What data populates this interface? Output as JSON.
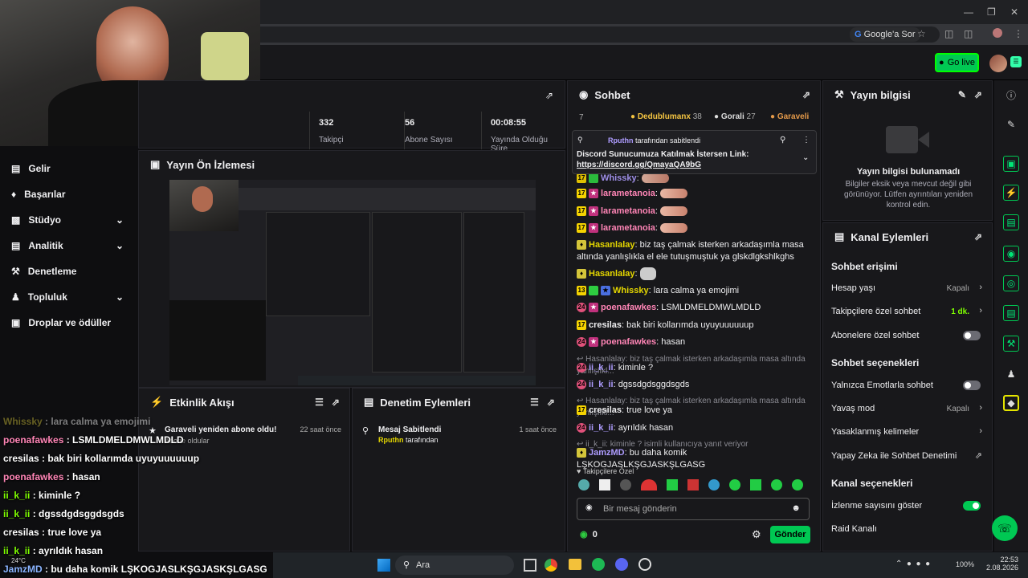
{
  "browser": {
    "google_sor": "Google'a Sor"
  },
  "header": {
    "go_live": "Go live"
  },
  "sidebar": {
    "items": [
      {
        "label": "Gelir",
        "icon": "wallet-icon",
        "chevron": false
      },
      {
        "label": "Başarılar",
        "icon": "trophy-icon",
        "chevron": false
      },
      {
        "label": "Stüdyo",
        "icon": "studio-icon",
        "chevron": true
      },
      {
        "label": "Analitik",
        "icon": "chart-icon",
        "chevron": true
      },
      {
        "label": "Denetleme",
        "icon": "wrench-icon",
        "chevron": false
      },
      {
        "label": "Topluluk",
        "icon": "people-icon",
        "chevron": true
      },
      {
        "label": "Droplar ve ödüller",
        "icon": "gift-icon",
        "chevron": false
      }
    ]
  },
  "stats": [
    {
      "value": "332",
      "label": "Takipçi"
    },
    {
      "value": "56",
      "label": "Abone Sayısı"
    },
    {
      "value": "00:08:55",
      "label": "Yayında Olduğu Süre"
    }
  ],
  "preview": {
    "title": "Yayın Ön İzlemesi"
  },
  "activity": {
    "title": "Etkinlik Akışı",
    "event_text": "Garaveli yeniden abone oldu!",
    "event_time": "22 saat önce",
    "event_sub": "Abone oldular"
  },
  "moderation": {
    "title": "Denetim Eylemleri",
    "action": "Mesaj Sabitlendi",
    "time": "1 saat önce",
    "actor": "Rputhn",
    "actor_suffix": "tarafından"
  },
  "chat": {
    "title": "Sohbet",
    "count": "7",
    "leaders": [
      {
        "rank": "1",
        "name": "Dedublumanx",
        "score": "38"
      },
      {
        "rank": "2",
        "name": "Gorali",
        "score": "27"
      },
      {
        "rank": "3",
        "name": "Garaveli",
        "score": ""
      }
    ],
    "pinned_by": "Rputhn",
    "pinned_suffix": "tarafından sabitlendi",
    "pinned_text": "Discord Sunucumuza Katılmak İstersen Link:",
    "pinned_link": "https://discord.gg/QmayaQA9bG",
    "messages": [
      {
        "user": "Whissky",
        "text": ":",
        "color": "u-g"
      },
      {
        "user": "larametanoia",
        "text": ":",
        "color": "u-pk"
      },
      {
        "user": "larametanoia",
        "text": ":",
        "color": "u-pk"
      },
      {
        "user": "larametanoia",
        "text": ":",
        "color": "u-pk"
      },
      {
        "user": "Hasanlalay",
        "text": ": biz taş çalmak isterken arkadaşımla masa altında yanlışlıkla el ele tutuşmuştuk ya glskdlgkshlkghs",
        "color": "u-y"
      },
      {
        "user": "Hasanlalay",
        "text": ":",
        "color": "u-y"
      },
      {
        "user": "Whissky",
        "text": ": lara calma ya emojimi",
        "color": "u-y"
      },
      {
        "user": "poenafawkes",
        "text": ": LSMLDMELDMWLMDLD",
        "color": "u-pk"
      },
      {
        "user": "cresilas",
        "text": ": bak biri kollarımda uyuyuuuuuup",
        "color": "u-w"
      },
      {
        "user": "poenafawkes",
        "text": ": hasan",
        "color": "u-pk"
      },
      {
        "reply": "Hasanlalay: biz taş çalmak isterken arkadaşımla masa altında yanlışlıkl..."
      },
      {
        "user": "ii_k_ii",
        "text": ": kiminle ?",
        "color": "u-g"
      },
      {
        "user": "ii_k_ii",
        "text": ": dgssdgdsggdsgds",
        "color": "u-g"
      },
      {
        "reply": "Hasanlalay: biz taş çalmak isterken arkadaşımla masa altında yanlışlıkl..."
      },
      {
        "user": "cresilas",
        "text": ": true love ya",
        "color": "u-w"
      },
      {
        "user": "ii_k_ii",
        "text": ": ayrıldık hasan",
        "color": "u-g"
      },
      {
        "reply": "ii_k_ii: kiminle ? isimli kullanıcıya yanıt veriyor"
      },
      {
        "user": "JamzMD",
        "text": ": bu daha komik LŞKOGJASLKŞGJASKŞLGASG",
        "color": "u-g"
      }
    ],
    "followers_only": "Takipçilere Özel",
    "input_placeholder": "Bir mesaj gönderin",
    "points": "0",
    "send": "Gönder"
  },
  "info": {
    "title": "Yayın bilgisi",
    "empty_title": "Yayın bilgisi bulunamadı",
    "empty_text": "Bilgiler eksik veya mevcut değil gibi görünüyor. Lütfen ayrıntıları yeniden kontrol edin."
  },
  "actions": {
    "title": "Kanal Eylemleri",
    "chat_access": "Sohbet erişimi",
    "account_age": "Hesap yaşı",
    "account_age_value": "Kapalı",
    "followers_chat": "Takipçilere özel sohbet",
    "followers_chat_value": "1 dk.",
    "subs_chat": "Abonelere özel sohbet",
    "chat_options": "Sohbet seçenekleri",
    "emote_only": "Yalnızca Emotlarla sohbet",
    "slow_mode": "Yavaş mod",
    "slow_mode_value": "Kapalı",
    "banned_words": "Yasaklanmış kelimeler",
    "ai_mod": "Yapay Zeka ile Sohbet Denetimi",
    "channel_options": "Kanal seçenekleri",
    "show_viewers": "İzlenme sayısını göster",
    "raid": "Raid Kanalı"
  },
  "overlay": {
    "lines": [
      {
        "user": "Whissky",
        "text": " : lara calma ya emojimi"
      },
      {
        "user": "poenafawkes",
        "text": " : LSMLDMELDMWLMDLD"
      },
      {
        "user": "cresilas",
        "text": " : bak biri kollarımda uyuyuuuuuup"
      },
      {
        "user": "poenafawkes",
        "text": " : hasan"
      },
      {
        "user": "ii_k_ii",
        "text": " : kiminle ?"
      },
      {
        "user": "ii_k_ii",
        "text": " : dgssdgdsggdsgds"
      },
      {
        "user": "cresilas",
        "text": " : true love ya"
      },
      {
        "user": "ii_k_ii",
        "text": " : ayrıldık hasan"
      },
      {
        "user": "JamzMD",
        "text": " : bu daha komik LŞKOGJASLKŞGJASKŞLGASG"
      }
    ],
    "temp": "24°C"
  },
  "taskbar": {
    "search": "Ara",
    "time": "22:53",
    "date": "2.08.2026",
    "battery": "100%"
  }
}
